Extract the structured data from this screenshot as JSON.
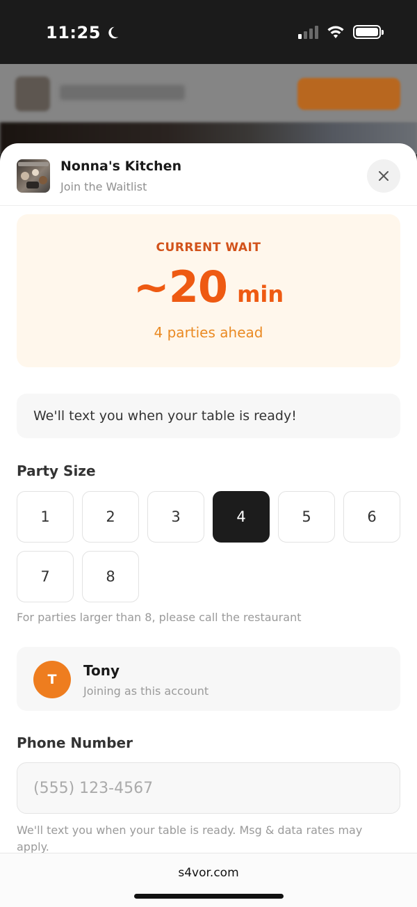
{
  "status_bar": {
    "time": "11:25",
    "icons": [
      "moon-icon",
      "signal-icon",
      "wifi-icon",
      "battery-icon"
    ]
  },
  "sheet": {
    "restaurant_name": "Nonna's Kitchen",
    "subtitle": "Join the Waitlist",
    "close_icon": "close-icon"
  },
  "wait": {
    "label": "CURRENT WAIT",
    "value": "~20",
    "unit": "min",
    "parties_ahead": "4 parties ahead"
  },
  "notice": "We'll text you when your table is ready!",
  "party_size": {
    "title": "Party Size",
    "options": [
      "1",
      "2",
      "3",
      "4",
      "5",
      "6",
      "7",
      "8"
    ],
    "selected": "4",
    "note": "For parties larger than 8, please call the restaurant"
  },
  "account": {
    "initial": "T",
    "name": "Tony",
    "subtitle": "Joining as this account"
  },
  "phone": {
    "title": "Phone Number",
    "placeholder": "(555) 123-4567",
    "value": "",
    "note": "We'll text you when your table is ready. Msg & data rates may apply."
  },
  "browser": {
    "url": "s4vor.com"
  },
  "colors": {
    "accent": "#EE5A12",
    "wait_card_bg": "#FFF7EC",
    "selected_bg": "#1C1C1C",
    "avatar_bg": "#EE7D1F"
  }
}
